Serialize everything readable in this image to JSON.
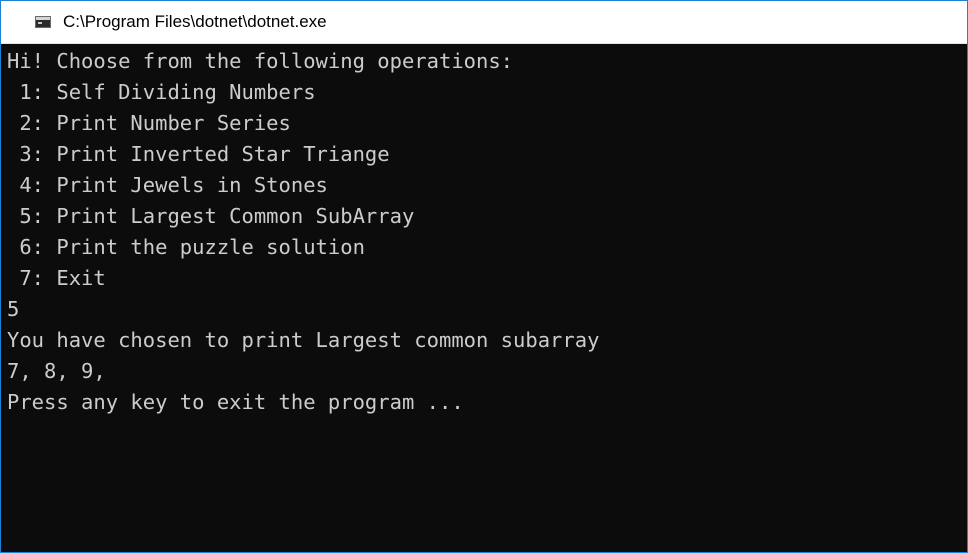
{
  "window": {
    "title": "C:\\Program Files\\dotnet\\dotnet.exe"
  },
  "console": {
    "lines": [
      "Hi! Choose from the following operations:",
      " 1: Self Dividing Numbers",
      " 2: Print Number Series",
      " 3: Print Inverted Star Triange",
      " 4: Print Jewels in Stones",
      " 5: Print Largest Common SubArray",
      " 6: Print the puzzle solution",
      " 7: Exit",
      "5",
      "You have chosen to print Largest common subarray",
      "7, 8, 9,",
      "Press any key to exit the program ..."
    ]
  },
  "colors": {
    "console_background": "#0c0c0c",
    "console_text": "#cccccc",
    "titlebar_background": "#ffffff",
    "window_border": "#1883d7"
  }
}
